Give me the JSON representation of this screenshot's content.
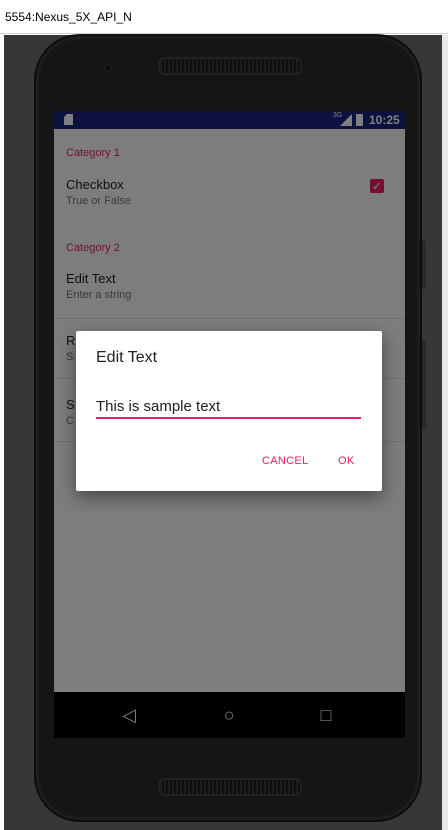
{
  "window": {
    "title": "5554:Nexus_5X_API_N"
  },
  "status_bar": {
    "time": "10:25",
    "network_type": "3G"
  },
  "preferences": {
    "category1": "Category 1",
    "checkbox": {
      "title": "Checkbox",
      "summary": "True or False",
      "checked": true
    },
    "category2": "Category 2",
    "edit_text": {
      "title": "Edit Text",
      "summary": "Enter a string"
    },
    "hidden_items": [
      {
        "title_partial": "R",
        "summary_partial": "S"
      },
      {
        "title_partial": "S",
        "summary_partial": "C"
      }
    ]
  },
  "dialog": {
    "title": "Edit Text",
    "input_value": "This is sample text",
    "cancel_label": "CANCEL",
    "ok_label": "OK"
  },
  "nav_bar": {
    "back": "◁",
    "home": "○",
    "recents": "□"
  },
  "colors": {
    "accent": "#e91e63",
    "status_bar": "#1a237e",
    "nav_bar": "#000000"
  }
}
